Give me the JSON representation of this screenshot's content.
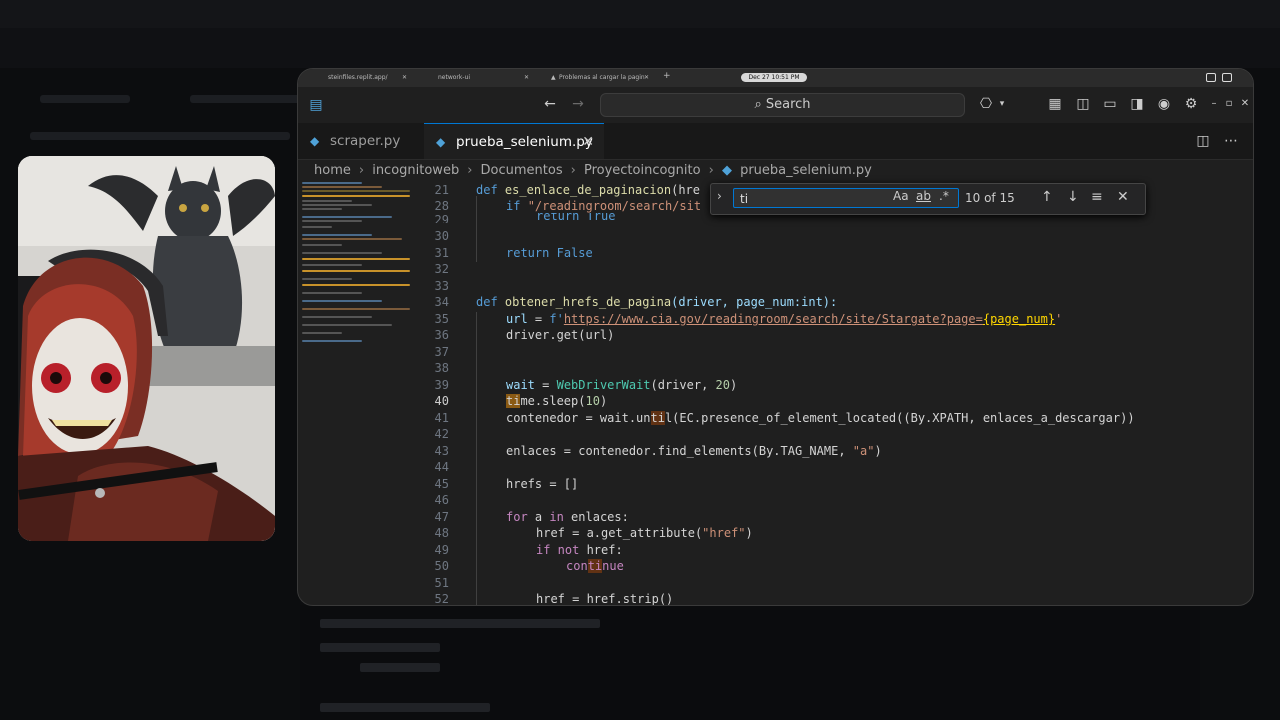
{
  "browser_tabs": [
    {
      "label": "steinfiles.replit.app/"
    },
    {
      "label": "network-ui"
    },
    {
      "label": "Problemas al cargar la pagin"
    }
  ],
  "clock": "Dec 27  10:51 PM",
  "search": {
    "label": "Search"
  },
  "editor_tabs": [
    {
      "label": "scraper.py",
      "active": false
    },
    {
      "label": "prueba_selenium.py",
      "active": true
    }
  ],
  "breadcrumb": [
    "home",
    "incognitoweb",
    "Documentos",
    "Proyectoincognito",
    "prueba_selenium.py"
  ],
  "find_widget": {
    "query": "ti",
    "match_case": "Aa",
    "whole_word": "ab",
    "regex": ".*",
    "count": "10 of 15"
  },
  "line_numbers": [
    "21",
    "28",
    "29",
    "30",
    "31",
    "32",
    "33",
    "34",
    "35",
    "36",
    "37",
    "38",
    "39",
    "40",
    "41",
    "42",
    "43",
    "44",
    "45",
    "46",
    "47",
    "48",
    "49",
    "50",
    "51",
    "52"
  ],
  "current_line": "40",
  "code": {
    "l21_def": "def",
    "l21_name": "es_enlace_de_paginacion",
    "l21_rest": "(hre",
    "l28_if": "if",
    "l28_str": "\"/readingroom/search/sit",
    "l29": "return True",
    "l31_return": "return",
    "l31_false": "False",
    "l34_def": "def",
    "l34_name": "obtener_hrefs_de_pagina",
    "l34_params": "(driver, page_num:int):",
    "l35_var": "url",
    "l35_eq": " = ",
    "l35_f": "f'",
    "l35_url": "https://www.cia.gov/readingroom/search/site/Stargate?page=",
    "l35_expr": "{page_num}",
    "l35_end": "'",
    "l36": "driver.get(url)",
    "l39_var": "wait",
    "l39_eq": " = ",
    "l39_cls": "WebDriverWait",
    "l39_args": "(driver, ",
    "l39_num": "20",
    "l39_end": ")",
    "l40_hl": "ti",
    "l40_rest": "me.sleep(",
    "l40_num": "10",
    "l40_end": ")",
    "l41_a": "contenedor = wait.un",
    "l41_hl": "ti",
    "l41_b": "l(EC.presence_of_element_located((By.XPATH, enlaces_a_descargar))",
    "l43_a": "enlaces = contenedor.find_elements(By.TAG_NAME, ",
    "l43_str": "\"a\"",
    "l43_end": ")",
    "l45": "hrefs = []",
    "l47_for": "for",
    "l47_a": " a ",
    "l47_in": "in",
    "l47_b": " enlaces:",
    "l48_a": "href = a.get_attribute(",
    "l48_str": "\"href\"",
    "l48_end": ")",
    "l49_if": "if not",
    "l49_b": " href:",
    "l50_a": "con",
    "l50_hl": "ti",
    "l50_b": "nue",
    "l52": "href = href.strip()"
  }
}
